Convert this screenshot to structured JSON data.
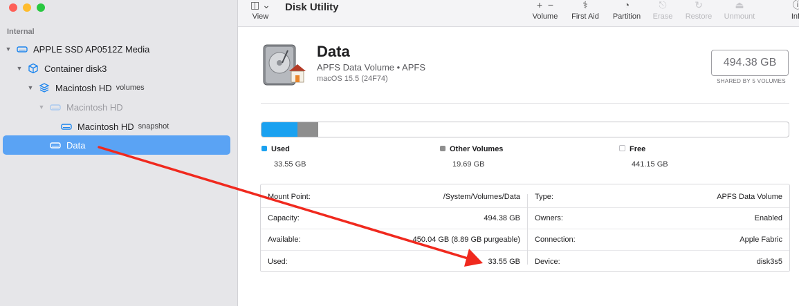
{
  "sidebar": {
    "section": "Internal",
    "items": [
      {
        "label": "APPLE SSD AP0512Z Media",
        "sub": "",
        "level": 0
      },
      {
        "label": "Container disk3",
        "sub": "",
        "level": 1
      },
      {
        "label": "Macintosh HD",
        "sub": "volumes",
        "level": 2
      },
      {
        "label": "Macintosh HD",
        "sub": "",
        "level": 3
      },
      {
        "label": "Macintosh HD",
        "sub": "snapshot",
        "level": 4
      },
      {
        "label": "Data",
        "sub": "",
        "level": 3
      }
    ]
  },
  "toolbar": {
    "title": "Disk Utility",
    "view": "View",
    "volume": "Volume",
    "first_aid": "First Aid",
    "partition": "Partition",
    "erase": "Erase",
    "restore": "Restore",
    "unmount": "Unmount",
    "info": "Info"
  },
  "volume": {
    "name": "Data",
    "subtitle": "APFS Data Volume • APFS",
    "os": "macOS 15.5 (24F74)",
    "size": "494.38 GB",
    "shared": "SHARED BY 5 VOLUMES"
  },
  "usage": {
    "used_fraction": 0.0679,
    "other_fraction": 0.0398,
    "colors": {
      "used": "#1aa1f0",
      "other": "#8e8e8e"
    },
    "legend": [
      {
        "label": "Used",
        "value": "33.55 GB"
      },
      {
        "label": "Other Volumes",
        "value": "19.69 GB"
      },
      {
        "label": "Free",
        "value": "441.15 GB"
      }
    ]
  },
  "info": {
    "left": [
      {
        "key": "Mount Point:",
        "value": "/System/Volumes/Data"
      },
      {
        "key": "Capacity:",
        "value": "494.38 GB"
      },
      {
        "key": "Available:",
        "value": "450.04 GB (8.89 GB purgeable)"
      },
      {
        "key": "Used:",
        "value": "33.55 GB"
      }
    ],
    "right": [
      {
        "key": "Type:",
        "value": "APFS Data Volume"
      },
      {
        "key": "Owners:",
        "value": "Enabled"
      },
      {
        "key": "Connection:",
        "value": "Apple Fabric"
      },
      {
        "key": "Device:",
        "value": "disk3s5"
      }
    ]
  },
  "annotation": {
    "arrow_color": "#f0291e"
  }
}
